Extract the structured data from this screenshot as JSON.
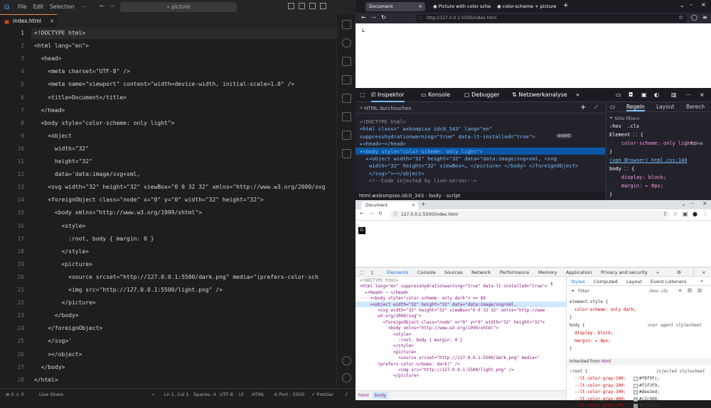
{
  "vscode": {
    "menu": [
      "File",
      "Edit",
      "Selection"
    ],
    "search": "picture",
    "tab": "index.html",
    "code": [
      {
        "n": "1",
        "t": "<!DOCTYPE html>"
      },
      {
        "n": "2",
        "t": "<html lang=\"en\">"
      },
      {
        "n": "3",
        "t": "  <head>"
      },
      {
        "n": "4",
        "t": "    <meta charset=\"UTF-8\" />"
      },
      {
        "n": "5",
        "t": "    <meta name=\"viewport\" content=\"width=device-width, initial-scale=1.0\" />"
      },
      {
        "n": "6",
        "t": "    <title>Document</title>"
      },
      {
        "n": "7",
        "t": "  </head>"
      },
      {
        "n": "8",
        "t": "  <body style=\"color-scheme: only light\">"
      },
      {
        "n": "9",
        "t": "    <object"
      },
      {
        "n": "10",
        "t": "      width=\"32\""
      },
      {
        "n": "11",
        "t": "      height=\"32\""
      },
      {
        "n": "12",
        "t": "      data='data:image/svg+xml,"
      },
      {
        "n": "13",
        "t": "    &lt;svg width=\"32\" height=\"32\" viewBox=\"0 0 32 32\" xmlns=\"http://www.w3.org/2000/svg"
      },
      {
        "n": "14",
        "t": "    &lt;foreignObject class=\"node\" x=\"0\" y=\"0\" width=\"32\" height=\"32\"&gt;"
      },
      {
        "n": "15",
        "t": "      &lt;body xmlns=\"http://www.w3.org/1999/xhtml\"&gt;"
      },
      {
        "n": "16",
        "t": "        &lt;style&gt;"
      },
      {
        "n": "17",
        "t": "          :root, body { margin: 0 }"
      },
      {
        "n": "18",
        "t": "        &lt;/style&gt;"
      },
      {
        "n": "19",
        "t": "        &lt;picture&gt;"
      },
      {
        "n": "20",
        "t": "          &lt;source srcset=\"http://127.0.0.1:5500/dark.png\" media=\"(prefers-color-sch"
      },
      {
        "n": "21",
        "t": "          &lt;img src=\"http://127.0.0.1:5500/light.png\" /&gt;"
      },
      {
        "n": "22",
        "t": "        &lt;/picture&gt;"
      },
      {
        "n": "23",
        "t": "      &lt;/body&gt;"
      },
      {
        "n": "24",
        "t": "    &lt;/foreignObject&gt;"
      },
      {
        "n": "25",
        "t": "    &lt;/svg&gt;'"
      },
      {
        "n": "26",
        "t": "    ></object>"
      },
      {
        "n": "27",
        "t": "  </body>"
      },
      {
        "n": "28",
        "t": "</html>"
      }
    ],
    "status": {
      "problems": "⊗ 0 ⚠ 0",
      "live": "Live Share",
      "pos": "Ln 1, Col 1",
      "spaces": "Spaces: 4",
      "enc": "UTF-8",
      "eol": "LF",
      "lang": "HTML",
      "port": "⊘ Port : 5500",
      "prettier": "✓ Prettier"
    }
  },
  "firefox": {
    "tabs": [
      "Document",
      "Picture with color sche",
      "color-scheme + picture in"
    ],
    "url": "http://127.0.0.1:5500/index.html",
    "page_char": "L",
    "devtools_tabs": [
      "Inspektor",
      "Konsole",
      "Debugger",
      "Netzwerkanalyse"
    ],
    "search": "HTML durchsuchen",
    "right_tabs": [
      "Regeln",
      "Layout",
      "Berech"
    ],
    "filter": "Stile filtern",
    "lines": [
      "<!DOCTYPE html>",
      "<html class=\" wxbsmpixo idc0_343\" lang=\"en\"",
      "suppresshydrationwarning=\"true\" data-lt-installed=\"true\">",
      "▸<head>⋯</head>",
      "▾<body style=\"color-scheme: only light\">",
      "  ▸<object width=\"32\" height=\"32\" data=\"data:image/svg+xml, <svg",
      "   width=\"32\" height=\"32\" viewBox=… </picture> </body> </foreignObject>",
      "   </svg>\">⋯</object>",
      "   <!--Code injected by live-server-->"
    ],
    "event_badge": "event",
    "breadcrumb": [
      "html.wxbsmpixo.idc0_343",
      "body",
      "script"
    ],
    "rules": [
      ":hov  .cls",
      "Element ⸬ {",
      "    color-scheme: only light;",
      "}",
      "(vpn Browser) html.css:140",
      "body ⸬ {",
      "    display: block;",
      "    margin: ▸ 8px;",
      "}"
    ],
    "inline": "Inline"
  },
  "chrome": {
    "tab": "Document",
    "url": "127.0.0.1:5500/index.html",
    "page_char": "D",
    "devtools_tabs": [
      "Elements",
      "Console",
      "Sources",
      "Network",
      "Performance",
      "Memory",
      "Application",
      "Privacy and security"
    ],
    "lines": [
      "<!DOCTYPE html>",
      "<html lang=\"en\" suppresshydrationwarning=\"true\" data-lt-installed=\"true\">",
      "  ▸<head> ⋯ </head>",
      "··· ▾<body style=\"color-scheme: only dark\"> == $0",
      "    ▾<object width=\"32\" height=\"32\" data=\"data:image/svg+xml,",
      "       <svg width=\"32\" height=\"32\" viewBox=\"0 0 32 32\" xmlns=\"http://www",
      "       w3.org/2000/svg\">",
      "         <foreignObject class=\"node\" x=\"0\" y=\"0\" width=\"32\" height=\"32\">",
      "           <body xmlns=\"http://www.w3.org/1999/xhtml\">",
      "             <style>",
      "               :root, body { margin: 0 }",
      "             </style>",
      "             <picture>",
      "               <source srcset=\"http://127.0.0.1:5500/dark.png\" media=\"",
      "       (prefers-color-scheme: dark)\" />",
      "               <img src=\"http://127.0.0.1:5500/light.png\" />",
      "             </picture>"
    ],
    "breadcrumb": [
      "html",
      "body"
    ],
    "style_tabs": [
      "Styles",
      "Computed",
      "Layout",
      "Event Listeners"
    ],
    "filter": "Filter",
    "hov": ":hov .cls",
    "styles": [
      {
        "t": "element.style {",
        "c": ""
      },
      {
        "t": "  color-scheme: only dark;",
        "c": ""
      },
      {
        "t": "}",
        "c": ""
      },
      {
        "t": "body {",
        "c": "user agent stylesheet"
      },
      {
        "t": "  display: block;",
        "c": ""
      },
      {
        "t": "  margin: ▸ 8px;",
        "c": ""
      },
      {
        "t": "}",
        "c": ""
      }
    ],
    "inherited": "Inherited from",
    "inherited_el": "html",
    "root_rule": ":root {",
    "root_note": "injected stylesheet",
    "vars": [
      {
        "k": "  --lt-color-gray-100:",
        "v": "#f8f9fc;",
        "col": "#f8f9fc"
      },
      {
        "k": "  --lt-color-gray-200:",
        "v": "#f1f3f9;",
        "col": "#f1f3f9"
      },
      {
        "k": "  --lt-color-gray-300:",
        "v": "#dee3ed;",
        "col": "#dee3ed"
      },
      {
        "k": "  --lt-color-gray-400:",
        "v": "#c2c9d6;",
        "col": "#c2c9d6"
      },
      {
        "k": "  --lt-color-gray-500:",
        "v": "#8f96a3;",
        "col": "#8f96a3"
      }
    ]
  }
}
